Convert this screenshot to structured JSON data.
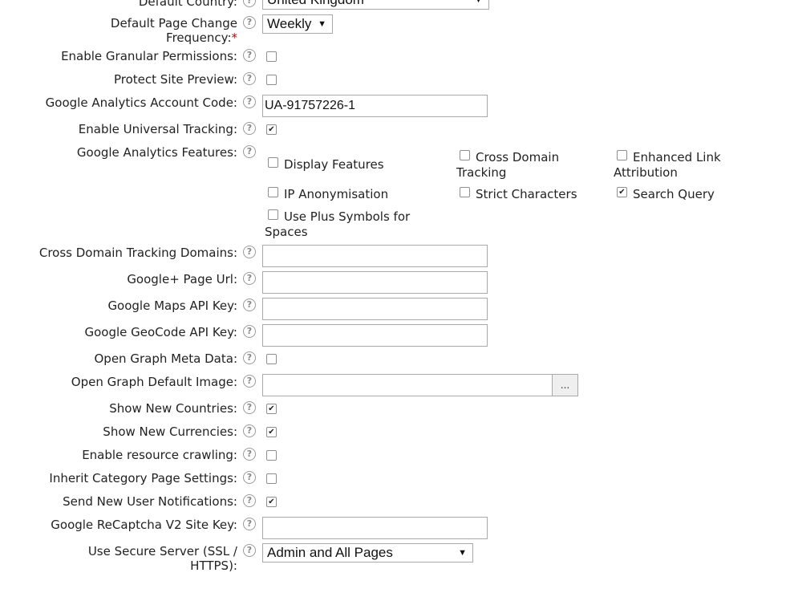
{
  "default_country": {
    "label": "Default Country:",
    "value": "United Kingdom"
  },
  "page_change_frequency": {
    "label_line1": "Default Page Change",
    "label_line2": "Frequency:",
    "required_mark": "*",
    "value": "Weekly"
  },
  "granular_permissions": {
    "label": "Enable Granular Permissions:",
    "checked": false
  },
  "protect_site_preview": {
    "label": "Protect Site Preview:",
    "checked": false
  },
  "ga_account_code": {
    "label": "Google Analytics Account Code:",
    "value": "UA-91757226-1"
  },
  "universal_tracking": {
    "label": "Enable Universal Tracking:",
    "checked": true
  },
  "ga_features": {
    "label": "Google Analytics Features:",
    "options": [
      {
        "label": "Display Features",
        "checked": false
      },
      {
        "label": "Cross Domain Tracking",
        "checked": false
      },
      {
        "label": "Enhanced Link Attribution",
        "checked": false
      },
      {
        "label": "IP Anonymisation",
        "checked": false
      },
      {
        "label": "Strict Characters",
        "checked": false
      },
      {
        "label": "Search Query",
        "checked": true
      },
      {
        "label": "Use Plus Symbols for Spaces",
        "checked": false
      }
    ]
  },
  "cross_domain_tracking_domains": {
    "label": "Cross Domain Tracking Domains:",
    "value": ""
  },
  "google_plus_url": {
    "label": "Google+ Page Url:",
    "value": ""
  },
  "google_maps_key": {
    "label": "Google Maps API Key:",
    "value": ""
  },
  "google_geocode_key": {
    "label": "Google GeoCode API Key:",
    "value": ""
  },
  "open_graph_meta": {
    "label": "Open Graph Meta Data:",
    "checked": false
  },
  "open_graph_image": {
    "label": "Open Graph Default Image:",
    "value": "",
    "browse_label": "..."
  },
  "show_new_countries": {
    "label": "Show New Countries:",
    "checked": true
  },
  "show_new_currencies": {
    "label": "Show New Currencies:",
    "checked": true
  },
  "resource_crawling": {
    "label": "Enable resource crawling:",
    "checked": false
  },
  "inherit_category": {
    "label": "Inherit Category Page Settings:",
    "checked": false
  },
  "send_user_notifications": {
    "label": "Send New User Notifications:",
    "checked": true
  },
  "recaptcha_key": {
    "label": "Google ReCaptcha V2 Site Key:",
    "value": ""
  },
  "secure_server": {
    "label_line1": "Use Secure Server (SSL /",
    "label_line2": "HTTPS):",
    "value": "Admin and All Pages"
  },
  "help_glyph": "?",
  "check_glyph": "✔",
  "select_arrow_glyph": "▼",
  "colors": {
    "required": "#d00000",
    "border": "#a9a9a9",
    "text": "#222222"
  }
}
